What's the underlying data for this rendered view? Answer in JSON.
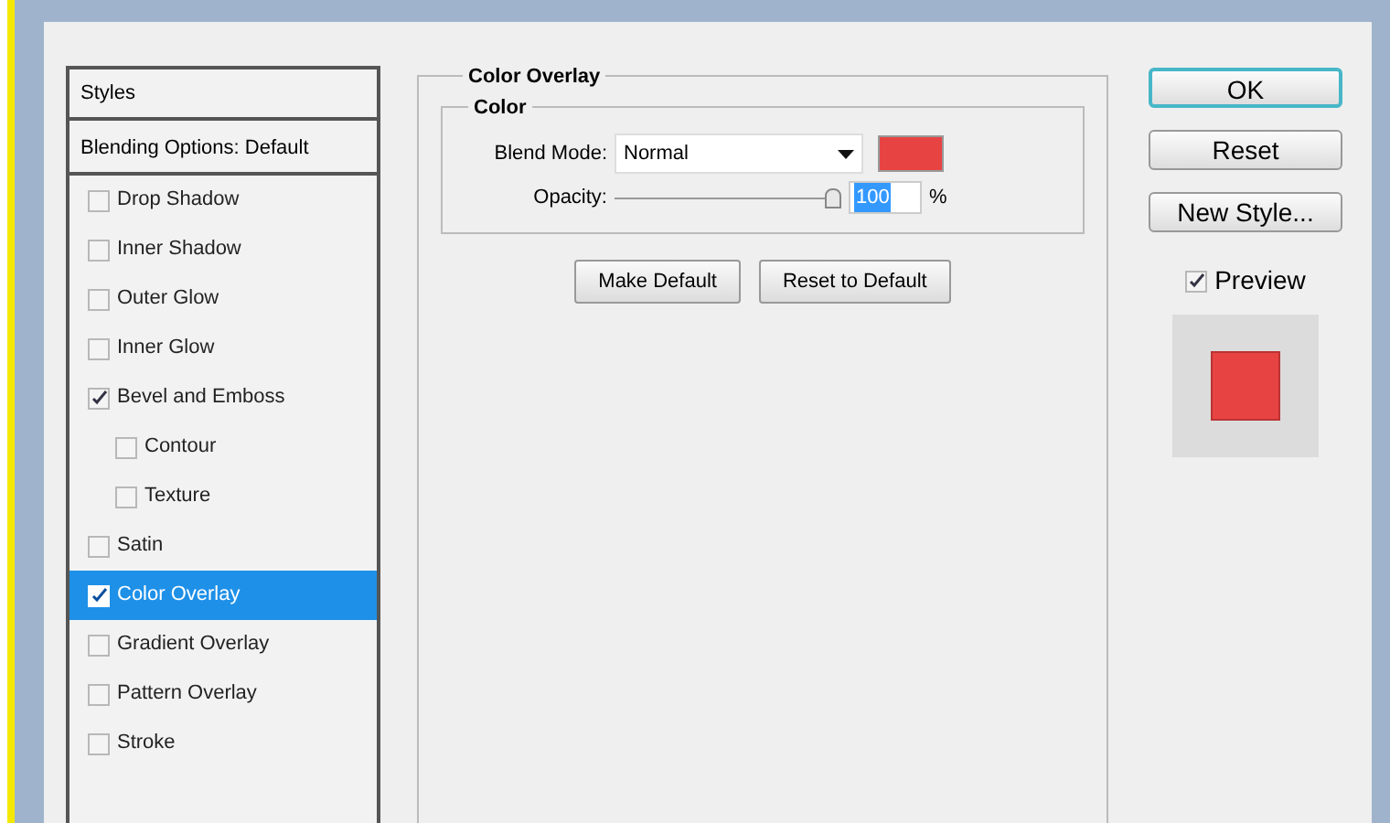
{
  "styles_list": {
    "header": "Styles",
    "blending_options": "Blending Options: Default",
    "items": [
      {
        "label": "Drop Shadow",
        "checked": false,
        "selected": false
      },
      {
        "label": "Inner Shadow",
        "checked": false,
        "selected": false
      },
      {
        "label": "Outer Glow",
        "checked": false,
        "selected": false
      },
      {
        "label": "Inner Glow",
        "checked": false,
        "selected": false
      },
      {
        "label": "Bevel and Emboss",
        "checked": true,
        "selected": false,
        "children": [
          {
            "label": "Contour",
            "checked": false,
            "selected": false
          },
          {
            "label": "Texture",
            "checked": false,
            "selected": false
          }
        ]
      },
      {
        "label": "Satin",
        "checked": false,
        "selected": false
      },
      {
        "label": "Color Overlay",
        "checked": true,
        "selected": true
      },
      {
        "label": "Gradient Overlay",
        "checked": false,
        "selected": false
      },
      {
        "label": "Pattern Overlay",
        "checked": false,
        "selected": false
      },
      {
        "label": "Stroke",
        "checked": false,
        "selected": false
      }
    ]
  },
  "panel": {
    "title": "Color Overlay",
    "group": "Color",
    "blend_mode_label": "Blend Mode:",
    "blend_mode": "Normal",
    "color": "#e84343",
    "opacity_label": "Opacity:",
    "opacity": {
      "level": 1
    },
    "opacity_value": "100",
    "opacity_unit": "%",
    "buttons": [
      "Make Default",
      "Reset to Default"
    ]
  },
  "actions": [
    {
      "label": "OK",
      "default": true
    },
    {
      "label": "Reset",
      "default": false
    },
    {
      "label": "New Style...",
      "default": false
    }
  ],
  "preview": {
    "label": "Preview",
    "checked": true,
    "color": "#e84343"
  }
}
